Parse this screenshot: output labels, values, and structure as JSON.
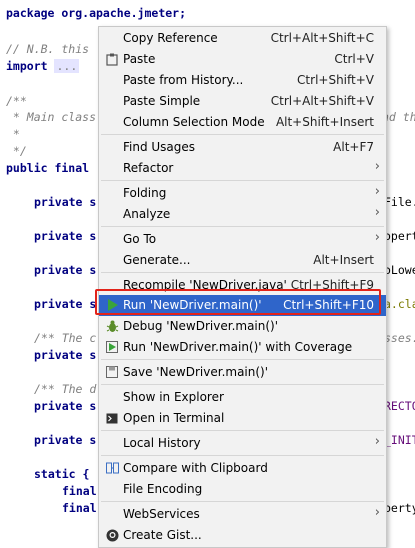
{
  "code": {
    "line1": "package org.apache.jmeter;",
    "line2_comment": "// N.B. this",
    "line3_kw": "import",
    "line3_fold": "...",
    "line4": "/**",
    "line5": " * Main class",
    "line5_right": "nd th",
    "line6": " *",
    "line7": " */",
    "line8_kw": "public final",
    "f1_kw": "private s",
    "f1_right": "File.",
    "f2_kw": "private s",
    "f2_right": "opert",
    "f3_kw": "private s",
    "f3_right": "oLowe",
    "f4_kw": "private s",
    "f4_right": "a.cla",
    "c1": "/** The c",
    "c1_right": "sses.",
    "f5_kw": "private s",
    "c2": "/** The d",
    "f6_kw": "private s",
    "f6_right": "RECTO",
    "f7_kw": "private s",
    "f7_right": "_INIT",
    "static_kw": "static {",
    "fin1": "final",
    "fin2": "final",
    "fin2_right": "perty"
  },
  "menu": {
    "copy_reference": {
      "label": "Copy Reference",
      "shortcut": "Ctrl+Alt+Shift+C"
    },
    "paste": {
      "label": "Paste",
      "shortcut": "Ctrl+V"
    },
    "paste_history": {
      "label": "Paste from History...",
      "shortcut": "Ctrl+Shift+V"
    },
    "paste_simple": {
      "label": "Paste Simple",
      "shortcut": "Ctrl+Alt+Shift+V"
    },
    "column_selection": {
      "label": "Column Selection Mode",
      "shortcut": "Alt+Shift+Insert"
    },
    "find_usages": {
      "label": "Find Usages",
      "shortcut": "Alt+F7"
    },
    "refactor": {
      "label": "Refactor"
    },
    "folding": {
      "label": "Folding"
    },
    "analyze": {
      "label": "Analyze"
    },
    "go_to": {
      "label": "Go To"
    },
    "generate": {
      "label": "Generate...",
      "shortcut": "Alt+Insert"
    },
    "recompile": {
      "label": "Recompile 'NewDriver.java'",
      "shortcut": "Ctrl+Shift+F9"
    },
    "run": {
      "label": "Run 'NewDriver.main()'",
      "shortcut": "Ctrl+Shift+F10"
    },
    "debug": {
      "label": "Debug 'NewDriver.main()'"
    },
    "run_coverage": {
      "label": "Run 'NewDriver.main()' with Coverage"
    },
    "save": {
      "label": "Save 'NewDriver.main()'"
    },
    "show_explorer": {
      "label": "Show in Explorer"
    },
    "open_terminal": {
      "label": "Open in Terminal"
    },
    "local_history": {
      "label": "Local History"
    },
    "compare_clipboard": {
      "label": "Compare with Clipboard"
    },
    "file_encoding": {
      "label": "File Encoding"
    },
    "webservices": {
      "label": "WebServices"
    },
    "create_gist": {
      "label": "Create Gist..."
    }
  },
  "colors": {
    "selection": "#2f65ca",
    "highlight_border": "#e2231a",
    "run_icon": "#3aa43a"
  }
}
